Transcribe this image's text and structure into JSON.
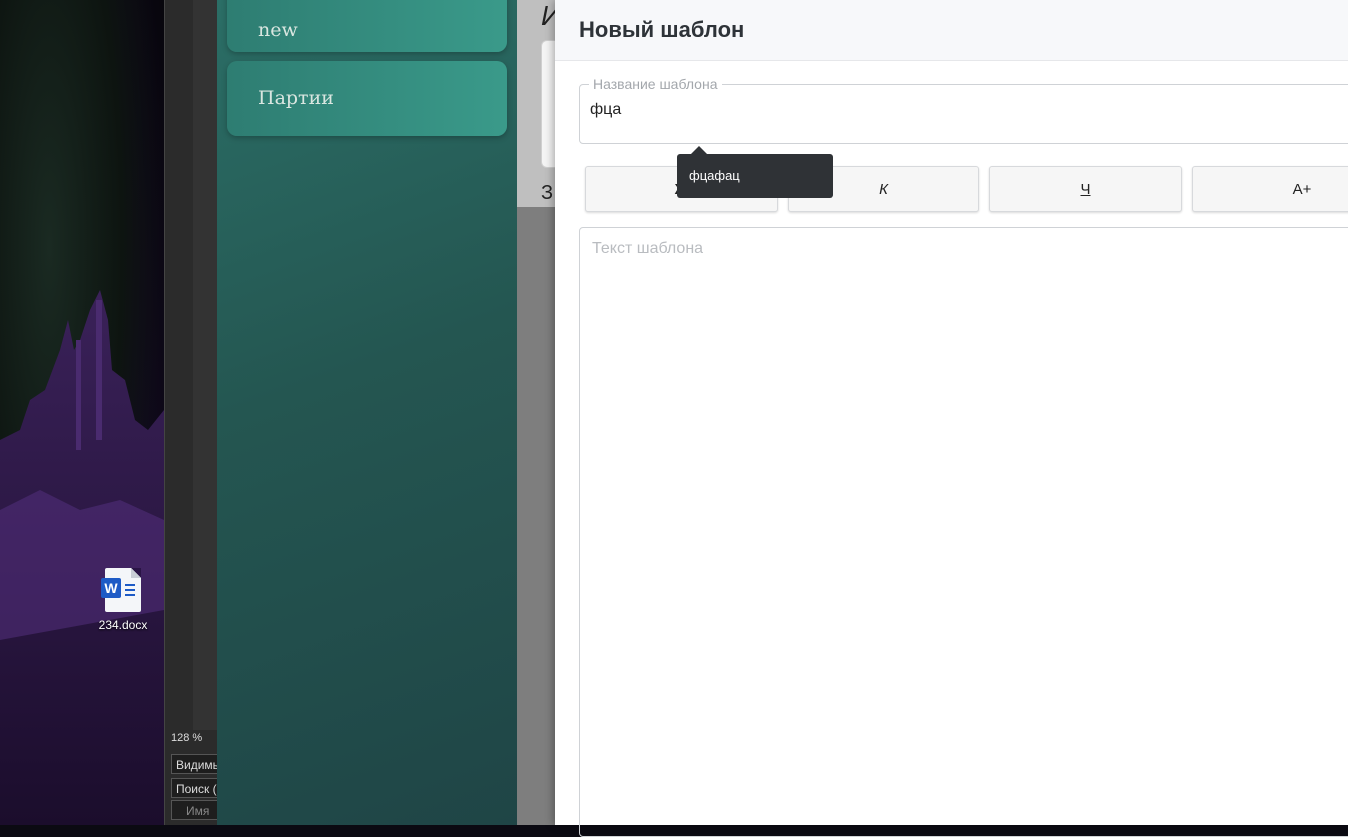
{
  "desktop": {
    "file": {
      "name": "234.docx",
      "icon": "word-doc-icon",
      "badge": "W"
    }
  },
  "app_strip": {
    "zoom": "128 %",
    "rows": [
      "Видимы",
      "Поиск (",
      "Имя"
    ]
  },
  "sidebar": {
    "items": [
      {
        "label": "new"
      },
      {
        "label": "Партии"
      }
    ]
  },
  "background_page": {
    "title_fragment": "И",
    "text_fragment": "З"
  },
  "modal": {
    "title": "Новый шаблон",
    "name_field": {
      "legend": "Название шаблона",
      "value": "фца"
    },
    "toolbar": {
      "buttons": [
        {
          "label": "Ж"
        },
        {
          "label": "К"
        },
        {
          "label": "Ч"
        },
        {
          "label": "A+"
        }
      ]
    },
    "text_field": {
      "placeholder": "Текст шаблона"
    }
  },
  "tooltip": {
    "text": "фцафац"
  },
  "colors": {
    "teal_sidebar": "#245651",
    "teal_card": "#2e7d72",
    "modal_header": "#f7f8fa",
    "tooltip_bg": "#2f3236"
  }
}
